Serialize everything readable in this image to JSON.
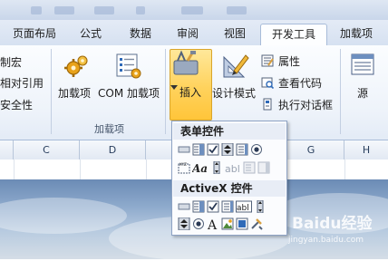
{
  "tabs": [
    "页面布局",
    "公式",
    "数据",
    "审阅",
    "视图",
    "开发工具",
    "加载项"
  ],
  "active_tab": "开发工具",
  "ribbon": {
    "code_partial": [
      "制宏",
      "相对引用",
      "安全性"
    ],
    "addins": {
      "addin_label": "加载项",
      "com_label": "COM 加载项",
      "group_label": "加载项"
    },
    "controls": {
      "insert_label": "插入",
      "design_label": "设计模式",
      "properties_label": "属性",
      "view_code_label": "查看代码",
      "run_dialog_label": "执行对话框"
    },
    "xml_partial": "源"
  },
  "columns": [
    "C",
    "D",
    "E",
    "F",
    "G",
    "H"
  ],
  "dropdown": {
    "form_controls_header": "表单控件",
    "activex_header": "ActiveX 控件"
  },
  "watermark": {
    "brand": "Baidu经验",
    "url": "jingyan.baidu.com"
  }
}
